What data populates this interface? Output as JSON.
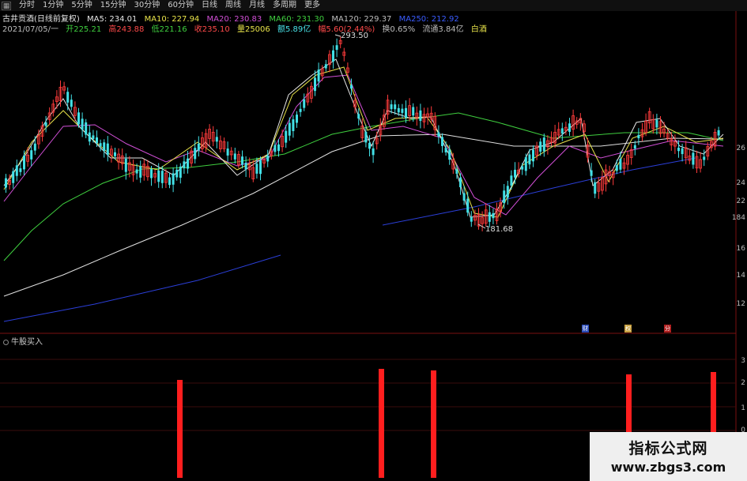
{
  "toolbar": {
    "icon": "grid-icon",
    "items": [
      "分时",
      "1分钟",
      "5分钟",
      "15分钟",
      "30分钟",
      "60分钟",
      "日线",
      "周线",
      "月线",
      "多周期",
      "更多"
    ]
  },
  "info_line1": {
    "title": "古井贡酒(日线前复权)",
    "ma5": "MA5: 234.01",
    "ma10": "MA10: 227.94",
    "ma20": "MA20: 230.83",
    "ma60": "MA60: 231.30",
    "ma120": "MA120: 229.37",
    "ma250": "MA250: 212.92"
  },
  "info_line2": {
    "date": "2021/07/05/一",
    "open": "开225.21",
    "high": "高243.88",
    "low": "低221.16",
    "close": "收235.10",
    "volume": "量25006",
    "amount": "额5.89亿",
    "change": "幅5.60(2.44%)",
    "turnover": "换0.65%",
    "float_cap": "流通3.84亿",
    "type": "白酒"
  },
  "price_labels": {
    "high": "293.50",
    "low": "181.68"
  },
  "axis": [
    "26",
    "24",
    "22",
    "184",
    "16",
    "14",
    "12",
    "3",
    "2",
    "1",
    "0"
  ],
  "event_markers": [
    "财",
    "权",
    "分"
  ],
  "indicator": {
    "title": "牛股买入"
  },
  "watermark": {
    "line1": "指标公式网",
    "line2": "www.zbgs3.com"
  },
  "colors": {
    "up": "#ff3b3b",
    "down": "#42e0e6",
    "ma5": "#e6e6e6",
    "ma10": "#e8e34a",
    "ma20": "#d14fd6",
    "ma60": "#3fcf3f",
    "ma120": "#e0e0e0",
    "ma250": "#2b3fd8",
    "signal_bar": "#ff1e1e"
  }
}
